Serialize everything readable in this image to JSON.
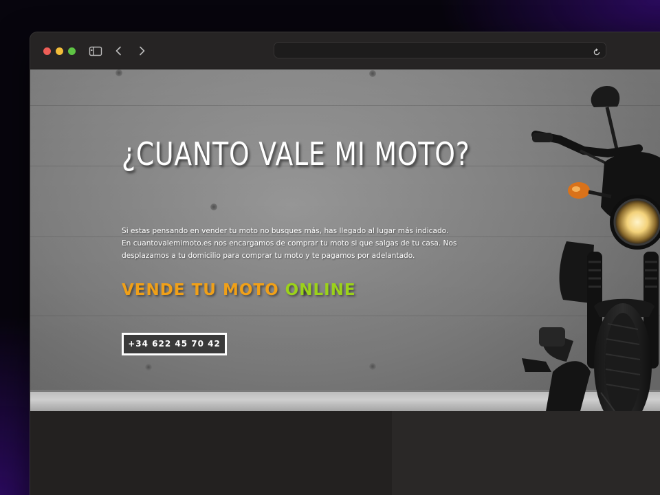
{
  "browser": {
    "url": "",
    "icons": {
      "sidebar": "sidebar-icon",
      "back": "chevron-left-icon",
      "forward": "chevron-right-icon",
      "reload": "reload-icon"
    }
  },
  "hero": {
    "title": "¿CUANTO VALE MI MOTO?",
    "description": "Si estas pensando en vender tu moto no busques más, has llegado al lugar más indicado. En cuantovalemimoto.es nos encargamos de comprar tu moto si que salgas de tu casa. Nos desplazamos a tu domicilio para comprar tu moto y te pagamos por adelantado.",
    "tagline_main": "VENDE TU MOTO ",
    "tagline_accent": "ONLINE",
    "phone_button": "+34 622 45 70 42"
  },
  "colors": {
    "tagline_main": "#f0a018",
    "tagline_accent": "#9bd21a",
    "button_bg": "#3a3a3a",
    "button_border": "#ffffff",
    "page_dark": "#232120"
  }
}
